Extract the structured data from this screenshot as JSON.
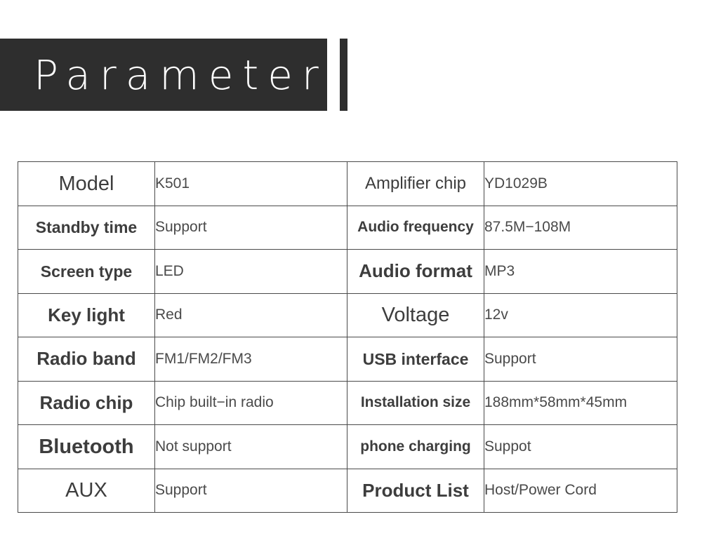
{
  "banner": {
    "title": "Parameter",
    "background_color": "#2e2e2e",
    "text_color": "#fdfdfd",
    "accent_bar": "|"
  },
  "page": {
    "background_color": "#ffffff",
    "border_color": "#4a4a4a",
    "label_text_color": "#3d3d3d",
    "value_text_color": "#4a4a4a"
  },
  "spec_table": {
    "rows": [
      {
        "left_label": "Model",
        "left_value": "K501",
        "right_label": "Amplifier chip",
        "right_value": "YD1029B"
      },
      {
        "left_label": "Standby time",
        "left_value": "Support",
        "right_label": "Audio frequency",
        "right_value": "87.5M−108M"
      },
      {
        "left_label": "Screen type",
        "left_value": "LED",
        "right_label": "Audio format",
        "right_value": "MP3"
      },
      {
        "left_label": "Key light",
        "left_value": "Red",
        "right_label": "Voltage",
        "right_value": "12v"
      },
      {
        "left_label": "Radio band",
        "left_value": "FM1/FM2/FM3",
        "right_label": "USB interface",
        "right_value": "Support"
      },
      {
        "left_label": "Radio chip",
        "left_value": "Chip built−in radio",
        "right_label": "Installation size",
        "right_value": "188mm*58mm*45mm"
      },
      {
        "left_label": "Bluetooth",
        "left_value": "Not support",
        "right_label": "phone charging",
        "right_value": "Suppot"
      },
      {
        "left_label": "AUX",
        "left_value": "Support",
        "right_label": "Product List",
        "right_value": "Host/Power Cord"
      }
    ]
  }
}
